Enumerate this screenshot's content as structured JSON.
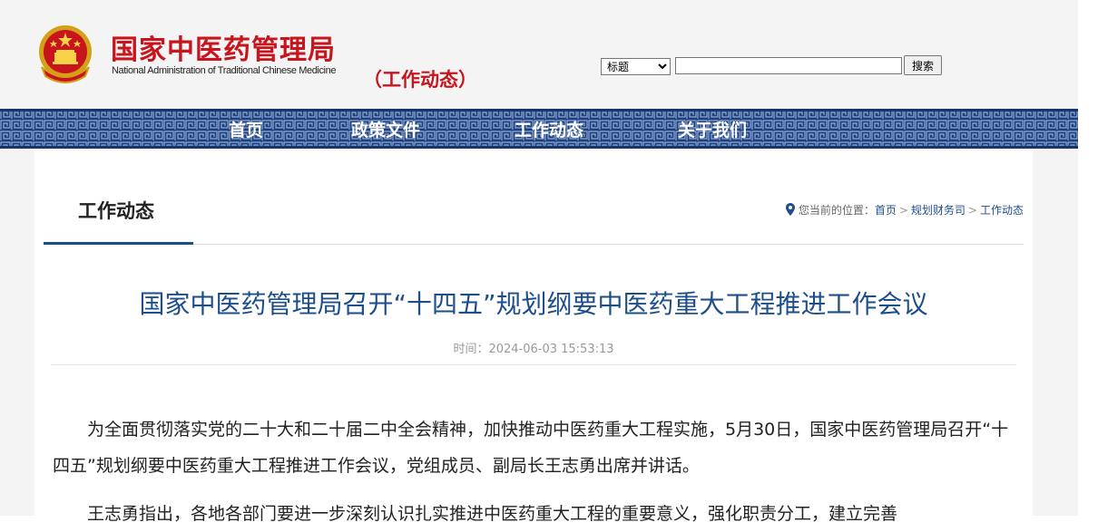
{
  "header": {
    "logo_cn": "国家中医药管理局",
    "logo_en": "National Administration of Traditional Chinese Medicine",
    "logo_sub": "（工作动态）"
  },
  "search": {
    "select_value": "标题",
    "button_label": "搜索"
  },
  "nav": {
    "items": [
      {
        "label": "首页"
      },
      {
        "label": "政策文件"
      },
      {
        "label": "工作动态"
      },
      {
        "label": "关于我们"
      }
    ]
  },
  "section": {
    "title": "工作动态"
  },
  "breadcrumb": {
    "prefix": "您当前的位置：",
    "items": [
      "首页",
      "规划财务司",
      "工作动态"
    ],
    "separator": ">"
  },
  "article": {
    "title": "国家中医药管理局召开“十四五”规划纲要中医药重大工程推进工作会议",
    "time": "时间：2024-06-03 15:53:13",
    "paragraphs": [
      "为全面贯彻落实党的二十大和二十届二中全会精神，加快推动中医药重大工程实施，5月30日，国家中医药管理局召开“十四五”规划纲要中医药重大工程推进工作会议，党组成员、副局长王志勇出席并讲话。",
      "王志勇指出，各地各部门要进一步深刻认识扎实推进中医药重大工程的重要意义，强化职责分工，建立完善"
    ]
  },
  "colors": {
    "brand_red": "#c8151d",
    "nav_blue": "#1d3f7c",
    "title_blue": "#1d4e8c"
  }
}
